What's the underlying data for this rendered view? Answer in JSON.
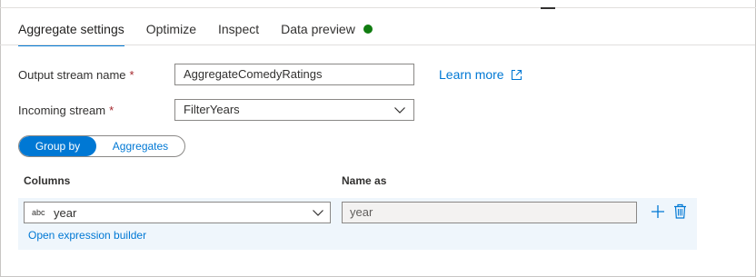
{
  "tabs": [
    {
      "label": "Aggregate settings",
      "active": true
    },
    {
      "label": "Optimize",
      "active": false
    },
    {
      "label": "Inspect",
      "active": false
    },
    {
      "label": "Data preview",
      "active": false,
      "status_color": "#107c10"
    }
  ],
  "form": {
    "output_stream": {
      "label": "Output stream name",
      "required_mark": "*",
      "value": "AggregateComedyRatings"
    },
    "incoming_stream": {
      "label": "Incoming stream",
      "required_mark": "*",
      "value": "FilterYears"
    },
    "learn_more": {
      "label": "Learn more",
      "icon": "open-in-new-window-icon"
    }
  },
  "pivot": {
    "group_by": "Group by",
    "aggregates": "Aggregates",
    "selected": "Group by"
  },
  "grid": {
    "columns_header": "Columns",
    "name_as_header": "Name as",
    "rows": [
      {
        "type_tag": "abc",
        "column": "year",
        "name_as": "year"
      }
    ],
    "expression_builder": "Open expression builder"
  },
  "colors": {
    "accent": "#0078d4",
    "required": "#a4262c",
    "status_ok": "#107c10",
    "row_background": "#eff6fc"
  }
}
